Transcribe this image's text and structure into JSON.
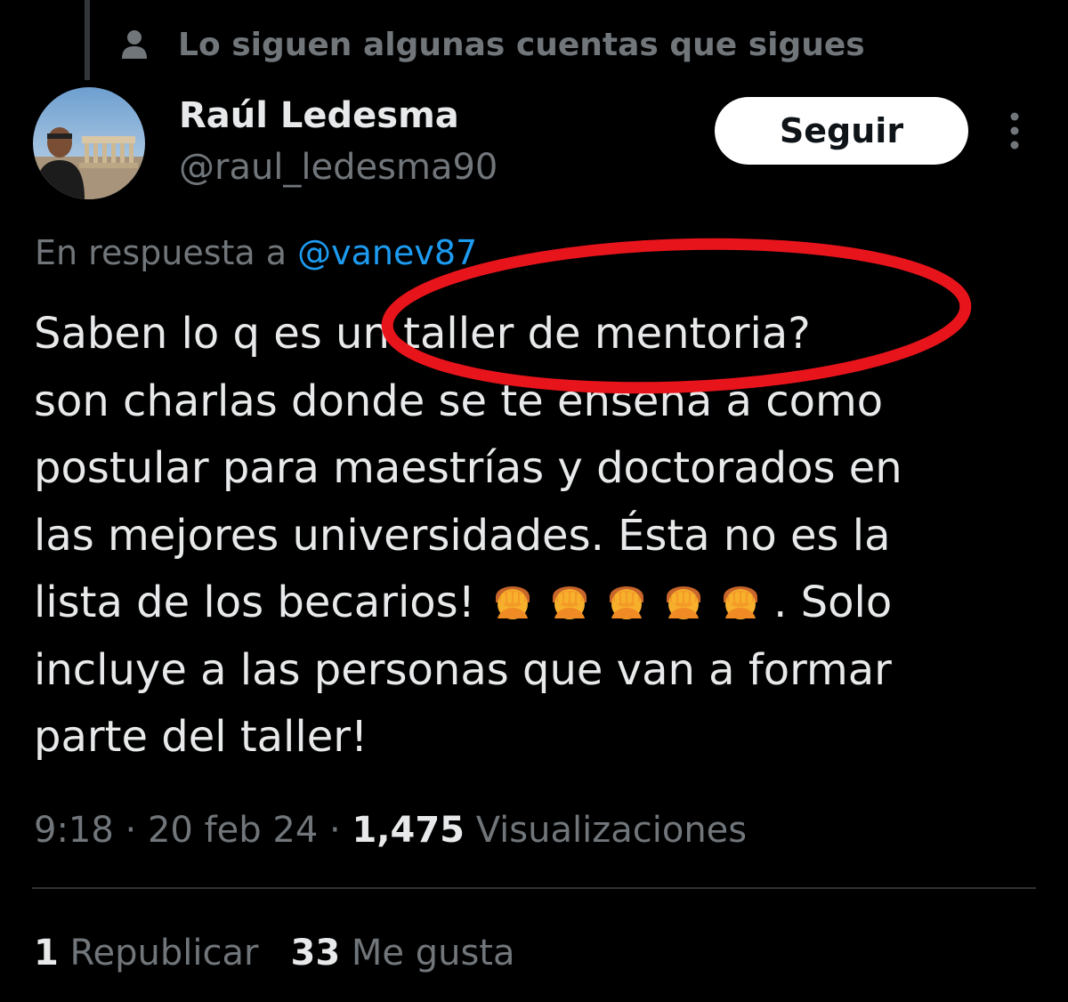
{
  "social_context": {
    "icon": "person-icon",
    "text": "Lo siguen algunas cuentas que sigues"
  },
  "author": {
    "display_name": "Raúl Ledesma",
    "handle": "@raul_ledesma90"
  },
  "follow_button": {
    "label": "Seguir"
  },
  "reply": {
    "prefix": "En respuesta a ",
    "mention": "@vanev87"
  },
  "tweet": {
    "lines": [
      "Saben lo q es un taller de mentoria?",
      "son charlas donde se te enseña a como",
      "postular para maestrías y doctorados en",
      "las mejores universidades. Ésta no es la",
      "lista de los becarios! ",
      "incluye a las personas que van a formar",
      "parte del taller!"
    ],
    "line5_suffix": ". Solo",
    "emoji": [
      "face-palm",
      "face-palm",
      "face-palm",
      "face-palm",
      "face-palm"
    ]
  },
  "meta": {
    "time": "9:18",
    "sep1": " · ",
    "date": "20 feb 24",
    "sep2": " · ",
    "views_count": "1,475",
    "views_label": " Visualizaciones"
  },
  "stats": {
    "reposts_count": "1",
    "reposts_label": " Republicar",
    "likes_count": "33",
    "likes_label": " Me gusta"
  },
  "colors": {
    "background": "#000000",
    "text": "#e7e9ea",
    "secondary": "#71767b",
    "link": "#1d9bf0",
    "annotation": "#e8141b"
  }
}
